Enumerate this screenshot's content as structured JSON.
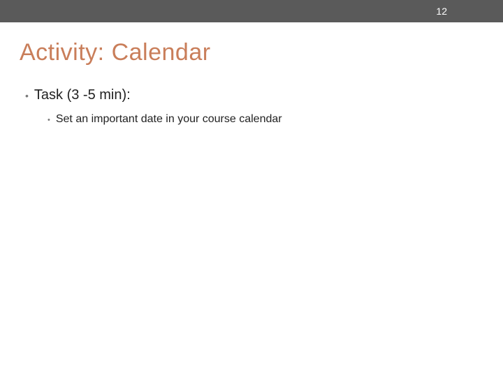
{
  "header": {
    "page_number": "12"
  },
  "slide": {
    "title": "Activity: Calendar",
    "bullets": {
      "level1": {
        "text": "Task (3 -5 min):"
      },
      "level2": {
        "text": "Set an important date in your course calendar"
      }
    }
  }
}
